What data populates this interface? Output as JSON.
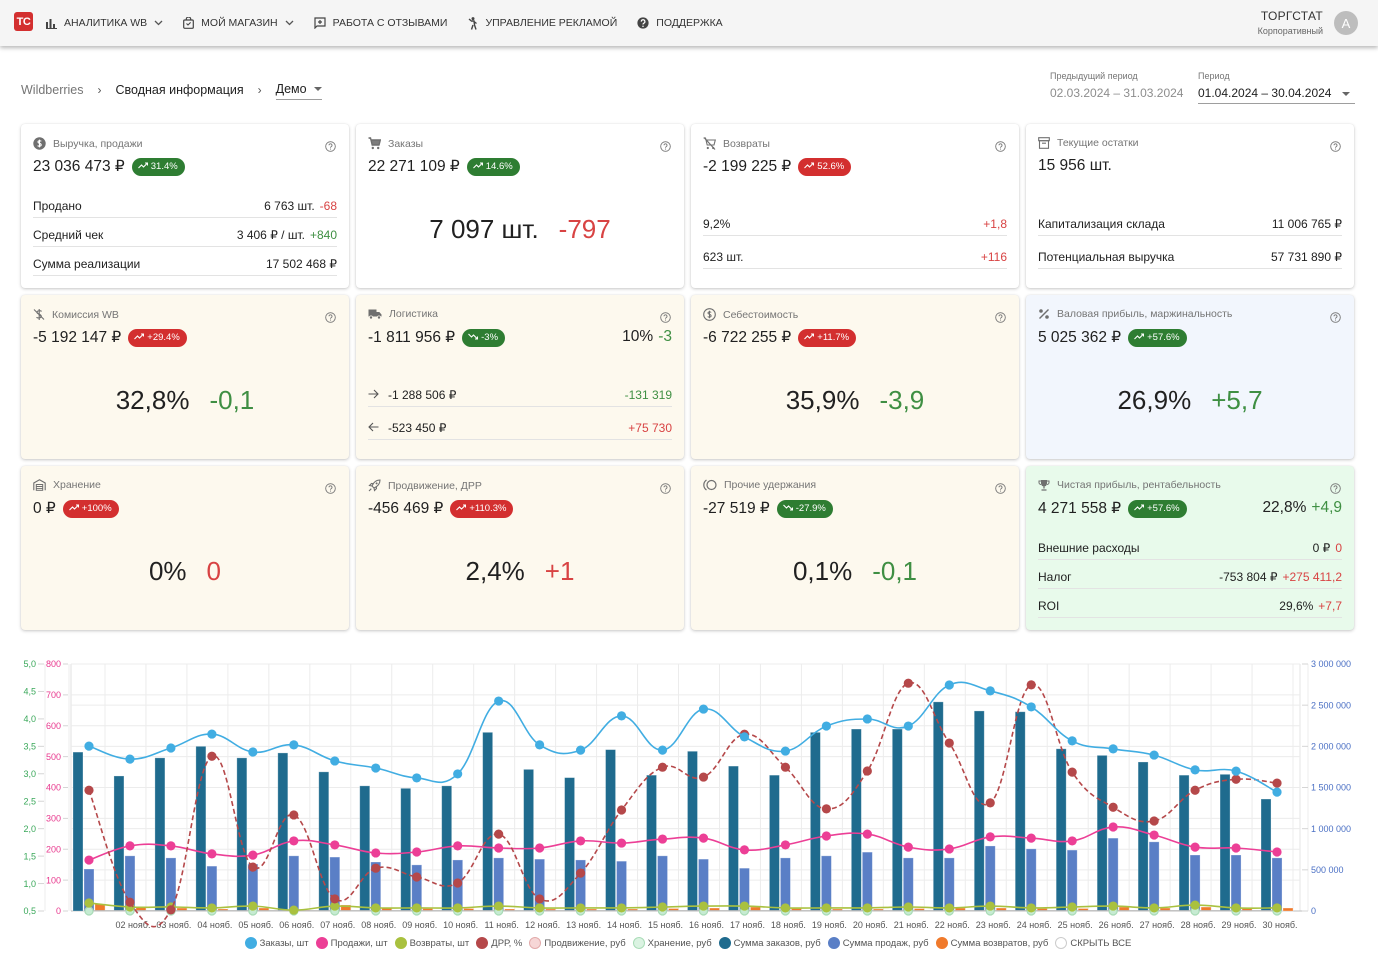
{
  "app": {
    "logo_text": "TC",
    "brand_color": "#d32f2f"
  },
  "nav": {
    "items": [
      {
        "label": "АНАЛИТИКА WB",
        "icon": "bar-chart-icon",
        "has_dropdown": true
      },
      {
        "label": "МОЙ МАГАЗИН",
        "icon": "shopping-bag-icon",
        "has_dropdown": true
      },
      {
        "label": "РАБОТА С ОТЗЫВАМИ",
        "icon": "feedback-icon",
        "has_dropdown": false
      },
      {
        "label": "УПРАВЛЕНИЕ РЕКЛАМОЙ",
        "icon": "advertising-icon",
        "has_dropdown": false
      },
      {
        "label": "ПОДДЕРЖКА",
        "icon": "help-circle-icon",
        "has_dropdown": false
      }
    ]
  },
  "user": {
    "name": "ТОРГСТАТ",
    "plan": "Корпоративный",
    "avatar_letter": "A"
  },
  "breadcrumb": {
    "root": "Wildberries",
    "current": "Сводная информация",
    "selector": "Демо"
  },
  "period": {
    "previous_label": "Предыдущий период",
    "previous_value": "02.03.2024 – 31.03.2024",
    "current_label": "Период",
    "current_value": "01.04.2024 – 30.04.2024"
  },
  "colors": {
    "positive": "#3f8f43",
    "negative": "#d84343",
    "badge_green": "#2e7d32",
    "badge_red": "#d32f2f"
  },
  "cards": {
    "revenue": {
      "title": "Выручка, продажи",
      "icon": "dollar-circle-icon",
      "value": "23 036 473 ₽",
      "badge": {
        "text": "31.4%",
        "trend": "up",
        "tone": "green"
      },
      "rows": [
        {
          "label": "Продано",
          "value": "6 763 шт.",
          "delta": "-68",
          "tone": "negative"
        },
        {
          "label": "Средний чек",
          "value": "3 406 ₽ / шт.",
          "delta": "+840",
          "tone": "positive"
        },
        {
          "label": "Сумма реализации",
          "value": "17 502 468 ₽"
        }
      ]
    },
    "orders": {
      "title": "Заказы",
      "icon": "cart-icon",
      "value": "22 271 109 ₽",
      "badge": {
        "text": "14.6%",
        "trend": "up",
        "tone": "green"
      },
      "big": {
        "value": "7 097 шт.",
        "delta": "-797",
        "tone": "negative"
      }
    },
    "returns": {
      "title": "Возвраты",
      "icon": "cart-off-icon",
      "value": "-2 199 225 ₽",
      "badge": {
        "text": "52.6%",
        "trend": "up",
        "tone": "red"
      },
      "rows": [
        {
          "label": "9,2%",
          "delta": "+1,8",
          "tone": "negative"
        },
        {
          "label": "623 шт.",
          "delta": "+116",
          "tone": "negative"
        }
      ]
    },
    "stock": {
      "title": "Текущие остатки",
      "icon": "archive-icon",
      "value": "15 956 шт.",
      "rows": [
        {
          "label": "Капитализация склада",
          "value": "11 006 765 ₽"
        },
        {
          "label": "Потенциальная выручка",
          "value": "57 731 890 ₽"
        }
      ]
    },
    "commission": {
      "title": "Комиссия WB",
      "icon": "money-off-icon",
      "value": "-5 192 147 ₽",
      "badge": {
        "text": "+29.4%",
        "trend": "up",
        "tone": "red"
      },
      "big": {
        "value": "32,8%",
        "delta": "-0,1",
        "tone": "positive"
      }
    },
    "logistics": {
      "title": "Логистика",
      "icon": "truck-icon",
      "value": "-1 811 956 ₽",
      "badge": {
        "text": "-3%",
        "trend": "down",
        "tone": "green"
      },
      "side": {
        "value": "10%",
        "delta": "-3",
        "tone": "positive"
      },
      "rows": [
        {
          "direction": "arrow-right-icon",
          "value": "-1 288 506 ₽",
          "delta": "-131 319",
          "tone": "positive"
        },
        {
          "direction": "arrow-left-icon",
          "value": "-523 450 ₽",
          "delta": "+75 730",
          "tone": "negative"
        }
      ]
    },
    "cost": {
      "title": "Себестоимость",
      "icon": "dollar-outline-icon",
      "value": "-6 722 255 ₽",
      "badge": {
        "text": "+11.7%",
        "trend": "up",
        "tone": "red"
      },
      "big": {
        "value": "35,9%",
        "delta": "-3,9",
        "tone": "positive"
      }
    },
    "gross": {
      "title": "Валовая прибыль, маржинальность",
      "icon": "percent-icon",
      "value": "5 025 362 ₽",
      "badge": {
        "text": "+57.6%",
        "trend": "up",
        "tone": "green"
      },
      "big": {
        "value": "26,9%",
        "delta": "+5,7",
        "tone": "positive"
      }
    },
    "storage": {
      "title": "Хранение",
      "icon": "warehouse-icon",
      "value": "0 ₽",
      "badge": {
        "text": "+100%",
        "trend": "up",
        "tone": "red"
      },
      "big": {
        "value": "0%",
        "delta": "0",
        "tone": "negative"
      }
    },
    "promotion": {
      "title": "Продвижение, ДРР",
      "icon": "rocket-icon",
      "value": "-456 469 ₽",
      "badge": {
        "text": "+110.3%",
        "trend": "up",
        "tone": "red"
      },
      "big": {
        "value": "2,4%",
        "delta": "+1",
        "tone": "negative"
      }
    },
    "other": {
      "title": "Прочие удержания",
      "icon": "other-deductions-icon",
      "value": "-27 519 ₽",
      "badge": {
        "text": "-27.9%",
        "trend": "down",
        "tone": "green"
      },
      "big": {
        "value": "0,1%",
        "delta": "-0,1",
        "tone": "positive"
      }
    },
    "net": {
      "title": "Чистая прибыль, рентабельность",
      "icon": "trophy-icon",
      "value": "4 271 558 ₽",
      "badge": {
        "text": "+57.6%",
        "trend": "up",
        "tone": "green"
      },
      "side": {
        "value": "22,8%",
        "delta": "+4,9",
        "tone": "positive"
      },
      "rows": [
        {
          "label": "Внешние расходы",
          "value": "0 ₽",
          "delta": "0",
          "tone": "negative"
        },
        {
          "label": "Налог",
          "value": "-753 804 ₽",
          "delta": "+275 411,2",
          "tone": "negative"
        },
        {
          "label": "ROI",
          "value": "29,6%",
          "delta": "+7,7",
          "tone": "negative"
        }
      ]
    }
  },
  "chart_data": {
    "type": "bar",
    "combo": true,
    "title": "",
    "categories": [
      "",
      "02 нояб.",
      "03 нояб.",
      "04 нояб.",
      "05 нояб.",
      "06 нояб.",
      "07 нояб.",
      "08 нояб.",
      "09 нояб.",
      "10 нояб.",
      "11 нояб.",
      "12 нояб.",
      "13 нояб.",
      "14 нояб.",
      "15 нояб.",
      "16 нояб.",
      "17 нояб.",
      "18 нояб.",
      "19 нояб.",
      "20 нояб.",
      "21 нояб.",
      "22 нояб.",
      "23 нояб.",
      "24 нояб.",
      "25 нояб.",
      "26 нояб.",
      "27 нояб.",
      "28 нояб.",
      "29 нояб.",
      "30 нояб."
    ],
    "grid": true,
    "legend_position": "bottom",
    "y_axes": [
      {
        "id": "drr",
        "side": "left-outer",
        "color": "#3aa85a",
        "range": [
          0.5,
          5.0
        ],
        "ticks": [
          "0,5",
          "1,0",
          "1,5",
          "2,0",
          "2,5",
          "3,0",
          "3,5",
          "4,0",
          "4,5",
          "5,0"
        ]
      },
      {
        "id": "count",
        "side": "left-inner",
        "color": "#e8388e",
        "range": [
          0,
          800
        ],
        "ticks": [
          "0",
          "100",
          "200",
          "300",
          "400",
          "500",
          "600",
          "700",
          "800"
        ]
      },
      {
        "id": "sum",
        "side": "right",
        "color": "#4a6fc4",
        "range": [
          0,
          3000000
        ],
        "ticks": [
          "0",
          "500 000",
          "1 000 000",
          "1 500 000",
          "2 000 000",
          "2 500 000",
          "3 000 000"
        ]
      }
    ],
    "series": [
      {
        "key": "sum_orders",
        "name": "Сумма заказов, руб",
        "mark": "bar",
        "axis": "sum",
        "color": "#1f6b8e",
        "values": [
          1930000,
          1640000,
          1860000,
          2000000,
          1860000,
          1920000,
          1690000,
          1520000,
          1490000,
          1520000,
          2170000,
          1720000,
          1620000,
          1960000,
          1650000,
          1940000,
          1760000,
          1650000,
          2170000,
          2210000,
          2210000,
          2540000,
          2430000,
          2420000,
          1970000,
          1890000,
          1810000,
          1650000,
          1660000,
          1360000
        ]
      },
      {
        "key": "sum_sales",
        "name": "Сумма продаж, руб",
        "mark": "bar",
        "axis": "sum",
        "color": "#5a7fc6",
        "values": [
          510000,
          670000,
          645000,
          545000,
          570000,
          670000,
          655000,
          595000,
          560000,
          620000,
          645000,
          630000,
          620000,
          605000,
          670000,
          630000,
          520000,
          645000,
          670000,
          715000,
          645000,
          645000,
          790000,
          755000,
          740000,
          885000,
          840000,
          680000,
          680000,
          645000
        ]
      },
      {
        "key": "sum_returns",
        "name": "Сумма возвратов, руб",
        "mark": "bar",
        "axis": "sum",
        "color": "#f07a2c",
        "values": [
          85000,
          48000,
          36000,
          24000,
          36000,
          12000,
          73000,
          36000,
          30000,
          30000,
          24000,
          24000,
          24000,
          24000,
          30000,
          36000,
          48000,
          30000,
          24000,
          24000,
          30000,
          36000,
          36000,
          30000,
          30000,
          48000,
          36000,
          48000,
          30000,
          36000
        ]
      },
      {
        "key": "promotion",
        "name": "Продвижение, руб",
        "mark": "line",
        "axis": "sum",
        "color": "#f3cccc",
        "values": [
          5000,
          5000,
          5000,
          5000,
          5000,
          5000,
          5000,
          5000,
          5000,
          5000,
          5000,
          5000,
          5000,
          5000,
          5000,
          5000,
          5000,
          5000,
          5000,
          5000,
          5000,
          5000,
          5000,
          5000,
          5000,
          5000,
          5000,
          5000,
          5000,
          5000
        ]
      },
      {
        "key": "storage",
        "name": "Хранение, руб",
        "mark": "line",
        "axis": "sum",
        "color": "#c6ebd2",
        "values": [
          0,
          0,
          0,
          0,
          0,
          0,
          0,
          0,
          0,
          0,
          0,
          0,
          0,
          0,
          0,
          0,
          0,
          0,
          0,
          0,
          0,
          0,
          0,
          0,
          0,
          0,
          0,
          0,
          0,
          0
        ]
      },
      {
        "key": "returns_cnt",
        "name": "Возвраты, шт",
        "mark": "line",
        "axis": "count",
        "color": "#a9c13f",
        "values": [
          26,
          13,
          13,
          10,
          16,
          3,
          16,
          10,
          10,
          10,
          16,
          10,
          10,
          10,
          13,
          16,
          16,
          10,
          10,
          10,
          13,
          10,
          16,
          10,
          13,
          16,
          10,
          19,
          10,
          10
        ]
      },
      {
        "key": "sales_cnt",
        "name": "Продажи, шт",
        "mark": "line",
        "axis": "count",
        "color": "#ec3f96",
        "values": [
          165,
          211,
          211,
          185,
          181,
          227,
          214,
          188,
          191,
          211,
          204,
          204,
          227,
          220,
          233,
          236,
          198,
          214,
          243,
          249,
          207,
          201,
          240,
          236,
          227,
          272,
          246,
          207,
          204,
          191
        ]
      },
      {
        "key": "drr",
        "name": "ДРР, %",
        "mark": "line",
        "dashed": true,
        "axis": "drr",
        "color": "#b5484a",
        "values": [
          2.7,
          0.66,
          0.52,
          3.32,
          1.3,
          2.25,
          0.72,
          1.28,
          1.12,
          1.01,
          1.9,
          0.72,
          1.19,
          2.34,
          3.12,
          2.94,
          3.72,
          3.12,
          2.36,
          3.05,
          4.65,
          3.56,
          2.47,
          4.62,
          3.03,
          2.39,
          2.14,
          2.7,
          2.9,
          2.83
        ]
      },
      {
        "key": "orders_cnt",
        "name": "Заказы, шт",
        "mark": "line",
        "axis": "count",
        "color": "#41ade2",
        "values": [
          534,
          492,
          528,
          573,
          515,
          538,
          486,
          463,
          431,
          444,
          680,
          538,
          521,
          632,
          521,
          654,
          564,
          518,
          599,
          622,
          599,
          732,
          713,
          661,
          551,
          525,
          505,
          457,
          453,
          385
        ]
      }
    ],
    "legend": [
      {
        "label": "Заказы, шт",
        "color": "#41ade2"
      },
      {
        "label": "Продажи, шт",
        "color": "#ec3f96"
      },
      {
        "label": "Возвраты, шт",
        "color": "#a9c13f"
      },
      {
        "label": "ДРР, %",
        "color": "#b5484a"
      },
      {
        "label": "Продвижение, руб",
        "color": "#f6d6d6",
        "border": "#e2aaaa"
      },
      {
        "label": "Хранение, руб",
        "color": "#dbf3e2",
        "border": "#a9dcb7"
      },
      {
        "label": "Сумма заказов, руб",
        "color": "#1f6b8e"
      },
      {
        "label": "Сумма продаж, руб",
        "color": "#5a7fc6"
      },
      {
        "label": "Сумма возвратов, руб",
        "color": "#f07a2c"
      },
      {
        "label": "СКРЫТЬ ВСЕ",
        "color": "#ffffff",
        "border": "#cccccc"
      }
    ]
  }
}
